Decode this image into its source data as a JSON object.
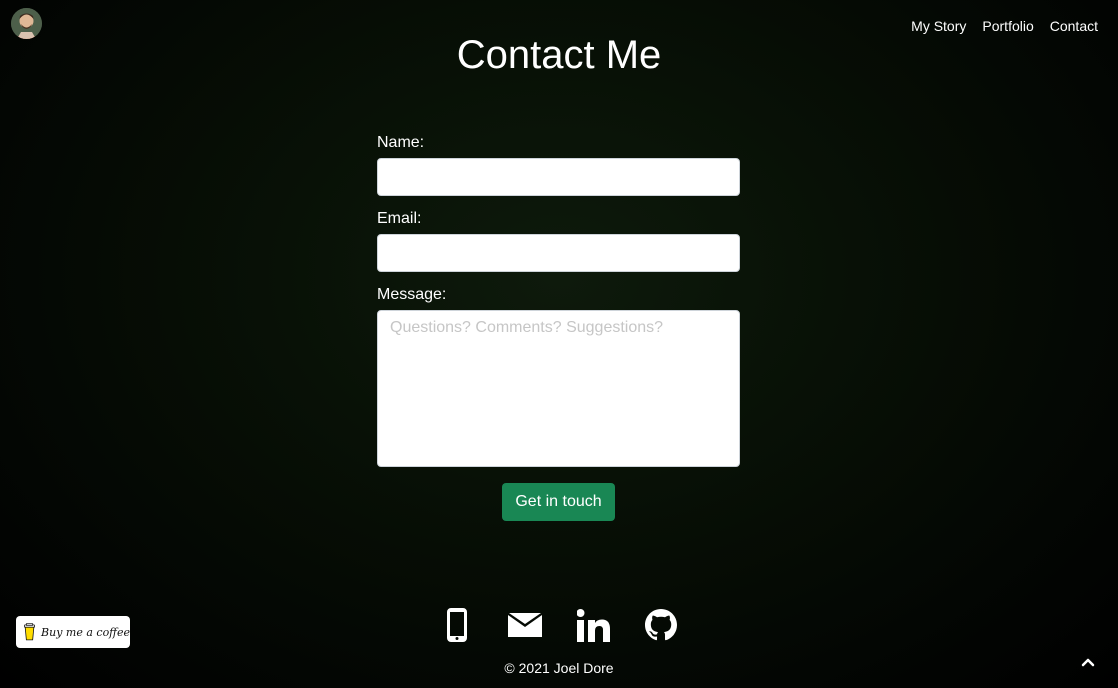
{
  "header": {
    "nav": [
      {
        "label": "My Story"
      },
      {
        "label": "Portfolio"
      },
      {
        "label": "Contact"
      }
    ]
  },
  "main": {
    "title": "Contact Me",
    "form": {
      "name_label": "Name:",
      "name_value": "",
      "email_label": "Email:",
      "email_value": "",
      "message_label": "Message:",
      "message_placeholder": "Questions? Comments? Suggestions?",
      "submit_label": "Get in touch"
    }
  },
  "footer": {
    "social": [
      {
        "icon": "phone-icon"
      },
      {
        "icon": "email-icon"
      },
      {
        "icon": "linkedin-icon"
      },
      {
        "icon": "github-icon"
      }
    ],
    "copyright": "© 2021 Joel Dore",
    "buy_me_coffee_label": "Buy me a coffee"
  },
  "colors": {
    "accent": "#198754",
    "background": "#000000"
  }
}
